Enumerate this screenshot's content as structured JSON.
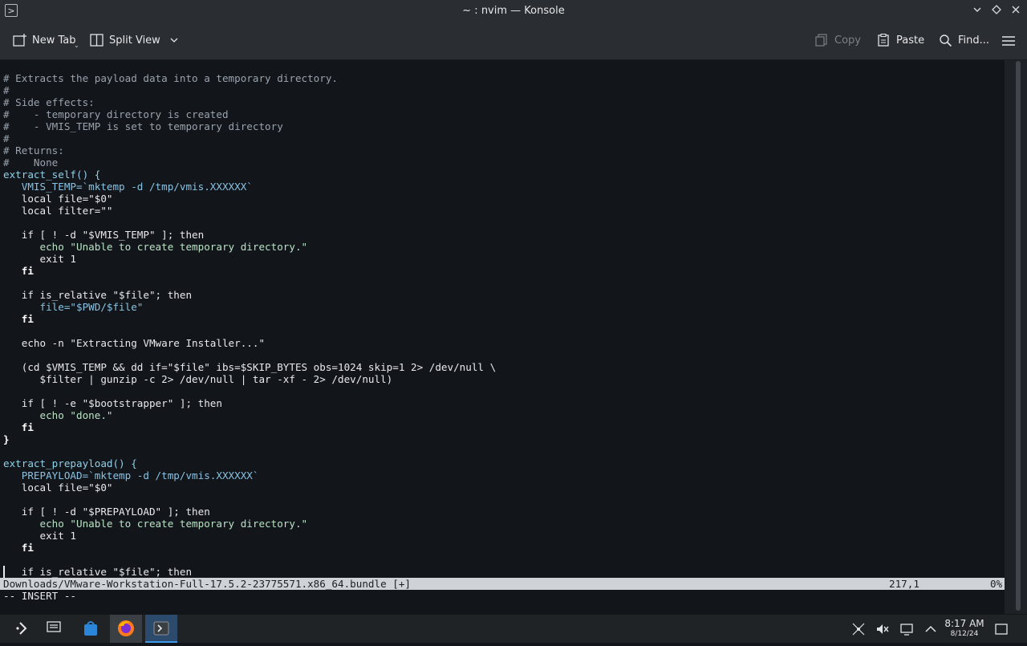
{
  "window": {
    "title": "~ : nvim — Konsole"
  },
  "toolbar": {
    "new_tab": "New Tab",
    "split_view": "Split View",
    "copy": "Copy",
    "paste": "Paste",
    "find": "Find..."
  },
  "editor": {
    "lines": [
      "# Extracts the payload data into a temporary directory.",
      "#",
      "# Side effects:",
      "#    - temporary directory is created",
      "#    - VMIS_TEMP is set to temporary directory",
      "#",
      "# Returns:",
      "#    None",
      "extract_self() {",
      "   VMIS_TEMP=`mktemp -d /tmp/vmis.XXXXXX`",
      "   local file=\"$0\"",
      "   local filter=\"\"",
      "",
      "   if [ ! -d \"$VMIS_TEMP\" ]; then",
      "      echo \"Unable to create temporary directory.\"",
      "      exit 1",
      "   fi",
      "",
      "   if is_relative \"$file\"; then",
      "      file=\"$PWD/$file\"",
      "   fi",
      "",
      "   echo -n \"Extracting VMware Installer...\"",
      "",
      "   (cd $VMIS_TEMP && dd if=\"$file\" ibs=$SKIP_BYTES obs=1024 skip=1 2> /dev/null \\",
      "      $filter | gunzip -c 2> /dev/null | tar -xf - 2> /dev/null)",
      "",
      "   if [ ! -e \"$bootstrapper\" ]; then",
      "      echo \"done.\"",
      "   fi",
      "}",
      "",
      "extract_prepayload() {",
      "   PREPAYLOAD=`mktemp -d /tmp/vmis.XXXXXX`",
      "   local file=\"$0\"",
      "",
      "   if [ ! -d \"$PREPAYLOAD\" ]; then",
      "      echo \"Unable to create temporary directory.\"",
      "      exit 1",
      "   fi",
      "",
      "   if is_relative \"$file\"; then"
    ],
    "status_file": "Downloads/VMware-Workstation-Full-17.5.2-23775571.x86_64.bundle [+]",
    "status_position": "217,1",
    "status_percent": "0%",
    "mode": "-- INSERT --"
  },
  "taskbar": {
    "clock_time": "8:17 AM",
    "clock_date": "8/12/24",
    "items": [
      "application-launcher-icon",
      "task-manager-icon",
      "store-icon",
      "firefox-icon",
      "konsole-icon"
    ]
  }
}
